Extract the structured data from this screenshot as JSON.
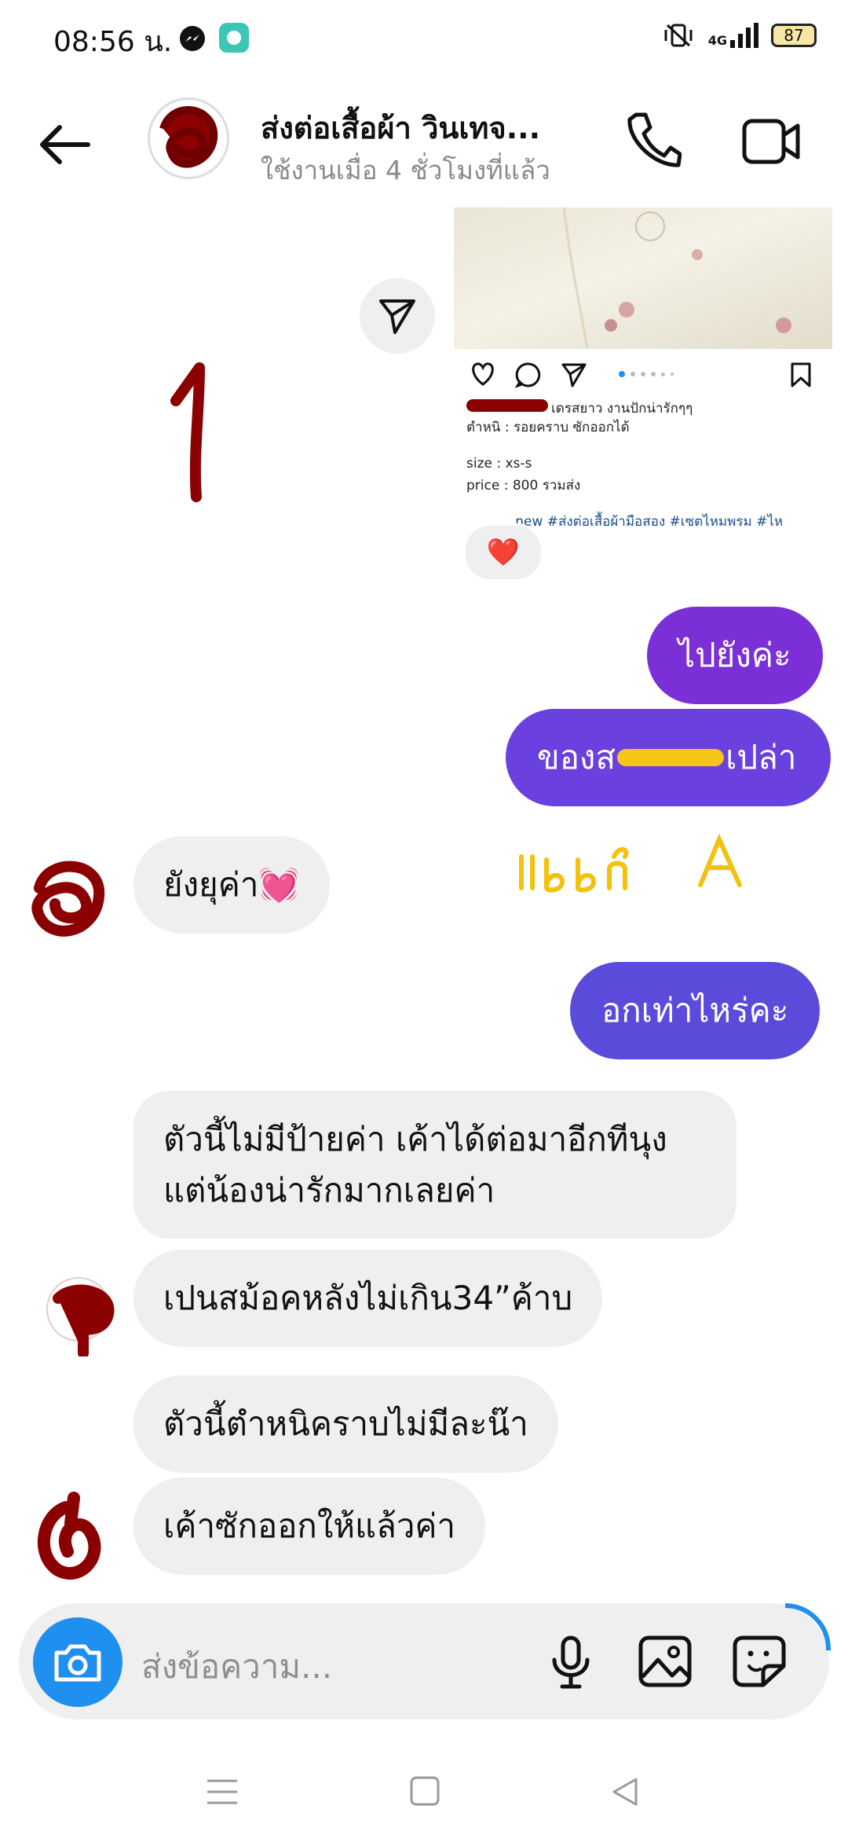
{
  "status_bar": {
    "time": "08:56 น.",
    "network": "4G",
    "battery": "87"
  },
  "header": {
    "title": "ส่งต่อเสื้อผ้า วินเทจ...",
    "subtitle": "ใช้งานเมื่อ 4 ชั่วโมงที่แล้ว"
  },
  "shared_post": {
    "caption_line1": "เดรสยาว งานปักน่ารักๆๆ",
    "caption_line2": "ตำหนิ : รอยคราบ ซักออกได้",
    "size": "size : xs-s",
    "price": "price : 800 รวมส่ง",
    "tags": "...new #ส่งต่อเสื้อผ้ามือสอง #เซตไหมพรม #ไห",
    "reaction": "❤️"
  },
  "annotations": {
    "number": "1",
    "handwritten_yellow": "แบบดั A"
  },
  "messages": {
    "out1": "ไปยังค่ะ",
    "out2_start": "ของส",
    "out2_end": "เปล่า",
    "in1": "ยังยุค่า💓",
    "out3": "อกเท่าไหร่คะ",
    "in2": "ตัวนี้ไม่มีป้ายค่า เค้าได้ต่อมาอีกทีนุง แต่น้องน่ารักมากเลยค่า",
    "in3": "เปนสม้อคหลังไม่เกิน34”ค้าบ",
    "in4": "ตัวนี้ตำหนิคราบไม่มีละน๊า",
    "in5": "เค้าซักออกให้แล้วค่า"
  },
  "composer": {
    "placeholder": "ส่งข้อความ..."
  },
  "colors": {
    "bubble_purple_top": "#7a2dd9",
    "bubble_purple_mid": "#6b3fe0",
    "bubble_indigo": "#5a4bdc",
    "incoming_bg": "#efefef",
    "camera_blue": "#1f8ff0"
  },
  "icons": [
    "back-arrow-icon",
    "phone-icon",
    "video-icon",
    "send-icon",
    "heart-icon",
    "comment-icon",
    "bookmark-icon",
    "camera-icon",
    "mic-icon",
    "gallery-icon",
    "sticker-icon"
  ]
}
